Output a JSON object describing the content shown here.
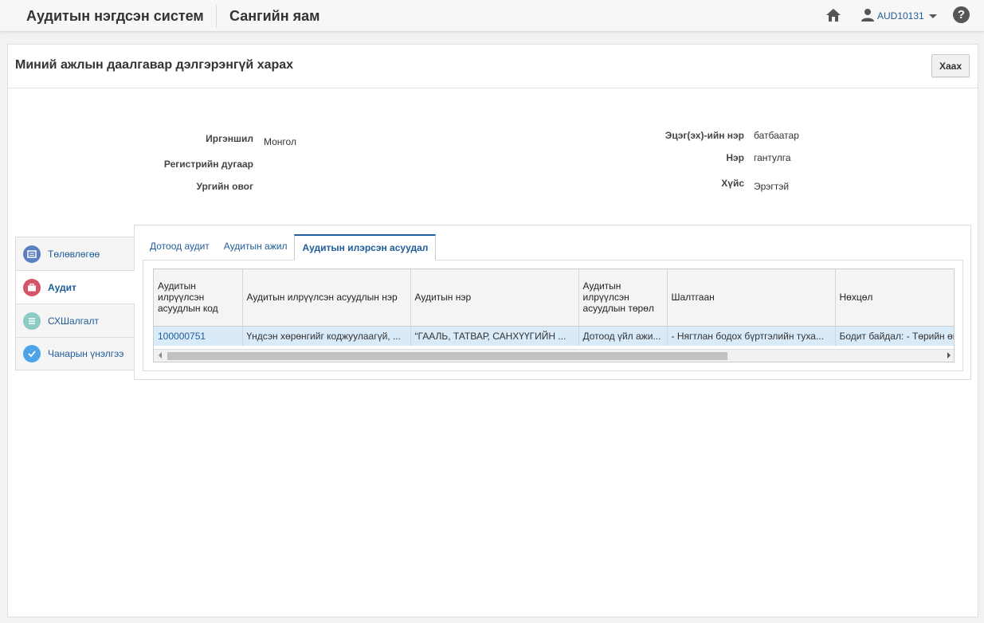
{
  "header": {
    "app_title": "Аудитын нэгдсэн систем",
    "org_title": "Сангийн яам",
    "username": "AUD10131"
  },
  "page": {
    "title": "Миний ажлын даалгавар дэлгэрэнгүй харах",
    "close_label": "Хаах"
  },
  "person": {
    "citizenship_label": "Иргэншил",
    "citizenship_value": "Монгол",
    "register_label": "Регистрийн дугаар",
    "register_value": "",
    "family_name_label": "Ургийн овог",
    "family_name_value": "",
    "father_label": "Эцэг(эх)-ийн нэр",
    "father_value": "батбаатар",
    "name_label": "Нэр",
    "name_value": "гантулга",
    "gender_label": "Хүйс",
    "gender_value": "Эрэгтэй"
  },
  "sidenav": {
    "items": [
      {
        "label": "Төлөвлөгөө",
        "icon": "plan-icon",
        "color": "#5b7fbf"
      },
      {
        "label": "Аудит",
        "icon": "briefcase-icon",
        "color": "#d6546a"
      },
      {
        "label": "СХШалгалт",
        "icon": "list-icon",
        "color": "#8ccbc4"
      },
      {
        "label": "Чанарын үнэлгээ",
        "icon": "check-icon",
        "color": "#4da3e8"
      }
    ]
  },
  "tabs": [
    {
      "label": "Дотоод аудит"
    },
    {
      "label": "Аудитын ажил"
    },
    {
      "label": "Аудитын илэрсэн асуудал"
    }
  ],
  "table": {
    "columns": [
      "Аудитын илрүүлсэн асуудлын код",
      "Аудитын илрүүлсэн асуудлын нэр",
      "Аудитын нэр",
      "Аудитын илрүүлсэн асуудлын төрөл",
      "Шалтгаан",
      "Нөхцөл"
    ],
    "rows": [
      [
        "100000751",
        "Үндсэн хөрөнгийг коджуулаагүй, ...",
        "“ГААЛЬ, ТАТВАР, САНХҮҮГИЙН ...",
        "Дотоод үйл ажи...",
        "- Нягтлан бодох бүртгэлийн туха...",
        "Бодит байдал: - Төрийн өм"
      ]
    ]
  },
  "colors": {
    "accent": "#1f5c99",
    "row_selected": "#d9eaf9"
  }
}
